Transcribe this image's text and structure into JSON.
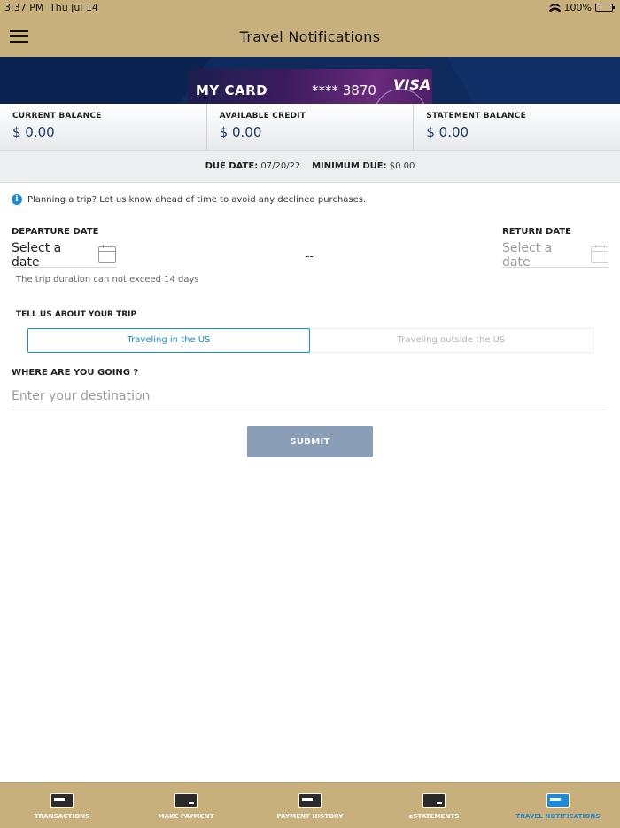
{
  "status": {
    "time": "3:37 PM",
    "date": "Thu Jul 14",
    "battery": "100%"
  },
  "header": {
    "title": "Travel Notifications"
  },
  "card": {
    "name": "MY CARD",
    "number": "**** 3870",
    "network": "VISA"
  },
  "balances": [
    {
      "label": "CURRENT BALANCE",
      "value": "$ 0.00"
    },
    {
      "label": "AVAILABLE CREDIT",
      "value": "$ 0.00"
    },
    {
      "label": "STATEMENT BALANCE",
      "value": "$ 0.00"
    }
  ],
  "due": {
    "due_label": "DUE DATE:",
    "due_value": "07/20/22",
    "min_label": "MINIMUM DUE:",
    "min_value": "$0.00"
  },
  "form": {
    "info": "Planning a trip? Let us know ahead of time to avoid any declined purchases.",
    "departure_label": "DEPARTURE DATE",
    "departure_value": "Select a date",
    "separator": "--",
    "return_label": "RETURN DATE",
    "return_value": "Select a date",
    "hint": "The trip duration can not exceed 14 days",
    "trip_label": "TELL US ABOUT YOUR TRIP",
    "options": [
      "Traveling in the US",
      "Traveling outside the US"
    ],
    "destination_label": "WHERE ARE YOU GOING ?",
    "destination_placeholder": "Enter your destination",
    "submit": "SUBMIT"
  },
  "tabs": [
    {
      "label": "TRANSACTIONS",
      "icon": "transactions-icon"
    },
    {
      "label": "MAKE PAYMENT",
      "icon": "payment-card-icon"
    },
    {
      "label": "PAYMENT HISTORY",
      "icon": "payment-history-icon"
    },
    {
      "label": "eSTATEMENTS",
      "icon": "estatements-icon"
    },
    {
      "label": "TRAVEL NOTIFICATIONS",
      "icon": "travel-icon"
    }
  ],
  "colors": {
    "header": "#c7b07b",
    "accent": "#1e8ad6",
    "navy": "#0e2a5c",
    "submit": "#8a9eb7"
  }
}
